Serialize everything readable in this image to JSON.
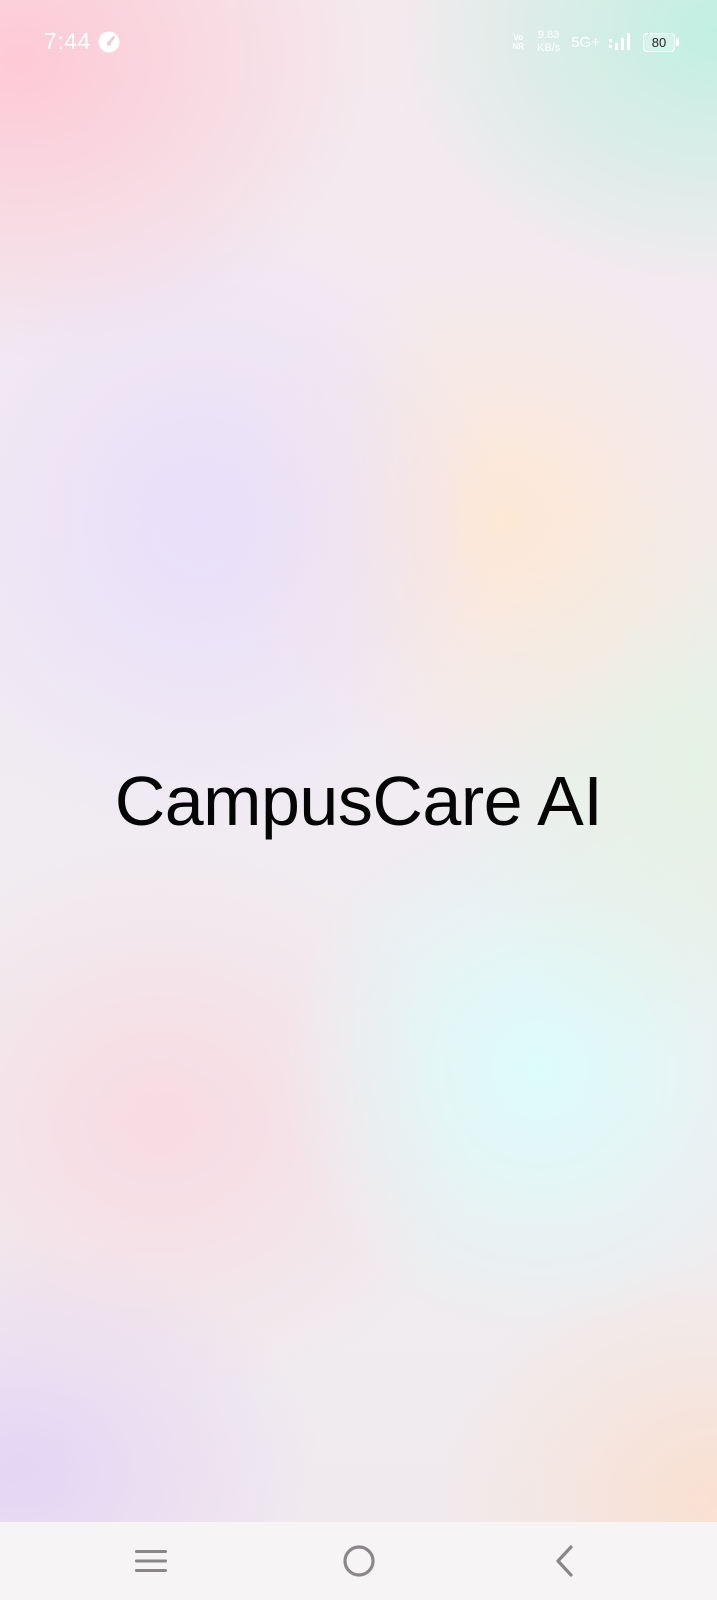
{
  "status_bar": {
    "time": "7:44",
    "volte_top": "Vo",
    "volte_bottom": "NR",
    "speed_value": "9.83",
    "speed_unit": "KB/s",
    "network_type": "5G+",
    "battery_level": "80",
    "app_icon": "speedometer-icon",
    "signal_icon": "signal-bars-icon"
  },
  "main": {
    "title": "CampusCare AI"
  },
  "nav_bar": {
    "menu_icon": "menu-lines-icon",
    "home_icon": "home-circle-icon",
    "back_icon": "back-chevron-icon"
  },
  "colors": {
    "title": "#050505",
    "status_text": "#ffffff",
    "nav_bar_bg": "#f7f4f6",
    "nav_icon": "#8a8689"
  }
}
